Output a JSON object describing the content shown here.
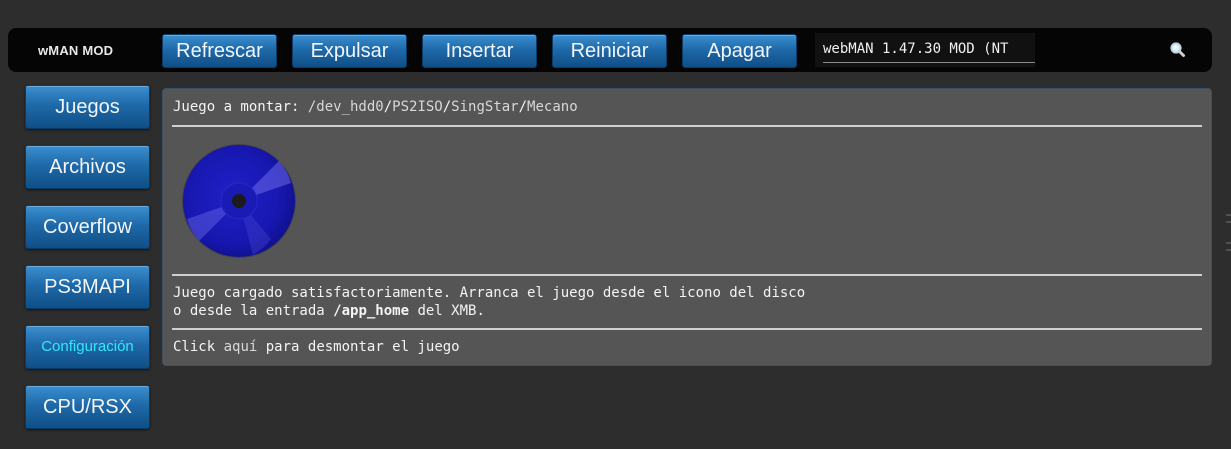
{
  "header": {
    "brand": "wMAN MOD",
    "buttons": [
      "Refrescar",
      "Expulsar",
      "Insertar",
      "Reiniciar",
      "Apagar"
    ],
    "version_text": "webMAN 1.47.30 MOD (NT",
    "search_icon": "search-icon"
  },
  "sidebar": {
    "items": [
      {
        "label": "Juegos"
      },
      {
        "label": "Archivos"
      },
      {
        "label": "Coverflow"
      },
      {
        "label": "PS3MAPI"
      },
      {
        "label": "Configuración",
        "active": true
      },
      {
        "label": "CPU/RSX"
      }
    ]
  },
  "main": {
    "mount_label": "Juego a montar: ",
    "path_root": "/dev_hdd0",
    "path_parts": [
      "PS2ISO",
      "SingStar",
      "Mecano"
    ],
    "disc_icon": "disc-icon",
    "message_line1": "Juego cargado satisfactoriamente. Arranca el juego desde el icono del disco",
    "message_line2_prefix": "o desde la entrada ",
    "message_line2_bold": "/app_home",
    "message_line2_suffix": " del XMB.",
    "unmount_click": "Click",
    "unmount_link": " aquí",
    "unmount_rest": " para desmontar el juego"
  },
  "colors": {
    "background": "#2d2d2d",
    "topbar": "#050505",
    "button_blue": "#1f69a9",
    "panel": "#555555",
    "active_text": "#33e6ff",
    "disc_blue": "#1a1ab5"
  }
}
